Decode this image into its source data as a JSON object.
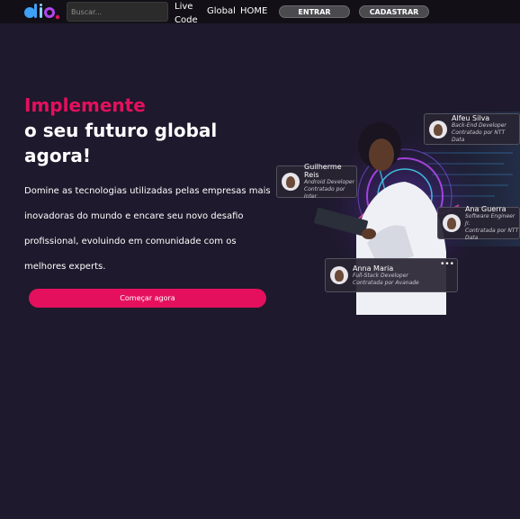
{
  "header": {
    "search_placeholder": "Buscar...",
    "nav": {
      "live_line1": "Live",
      "live_line2": "Code",
      "global": "Global",
      "home": "HOME"
    },
    "entrar_label": "ENTRAR",
    "cadastrar_label": "CADASTRAR"
  },
  "hero": {
    "title_highlight": "Implemente",
    "title_line2": "o seu futuro global",
    "title_line3": "agora!",
    "description_lines": [
      "Domine as tecnologias utilizadas pelas empresas mais",
      "inovadoras do mundo e encare seu novo desafio",
      "profissional, evoluindo em comunidade com os",
      "melhores experts."
    ],
    "cta_label": "Começar agora"
  },
  "profiles": [
    {
      "name": "Alfeu Silva",
      "role": "Back-End Developer",
      "company": "Contratado por NTT Data"
    },
    {
      "name": "Guilherme Reis",
      "role": "Android Developer",
      "company": "Contratado por Inter"
    },
    {
      "name": "Ana Guerra",
      "role": "Software Engineer Jr.",
      "company": "Contratada por NTT Data"
    },
    {
      "name": "Anna Maria",
      "role": "Full-Stack Developer",
      "company": "Contratada por Avanade"
    }
  ],
  "colors": {
    "background": "#1e192c",
    "topbar": "#121016",
    "accent": "#e4105d"
  },
  "icons": {
    "logo": "dio-logo",
    "more": "more-dots-icon"
  }
}
